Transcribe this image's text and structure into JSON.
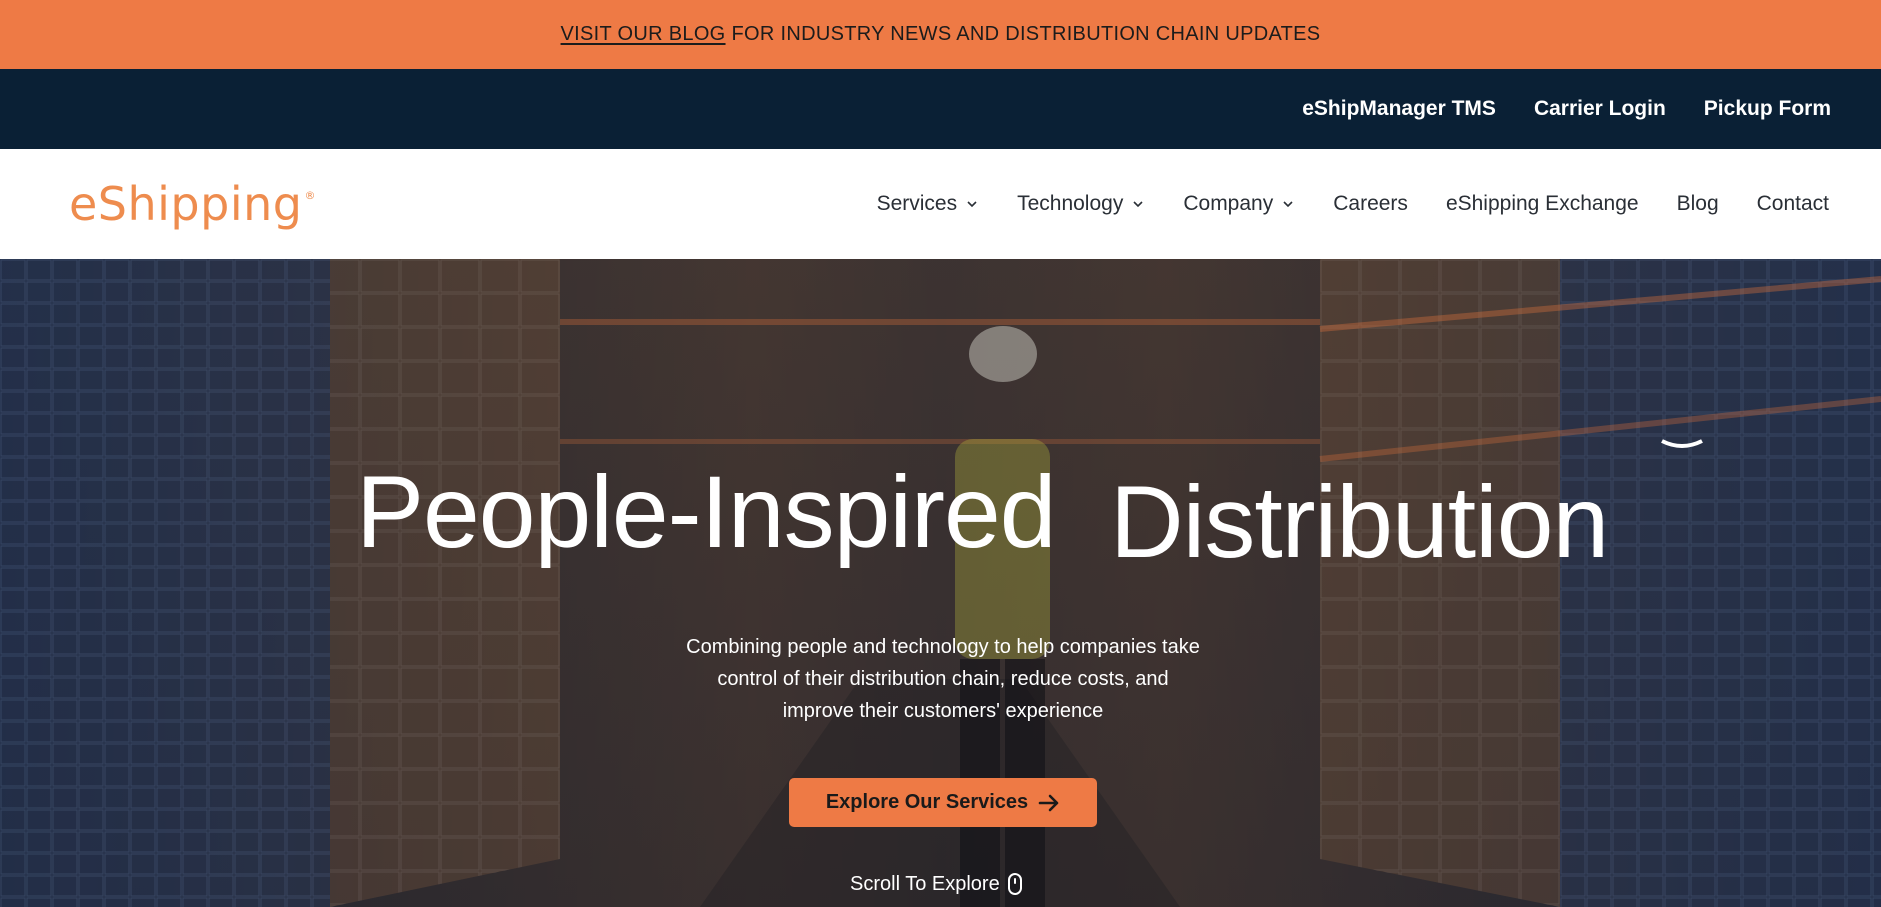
{
  "announcement": {
    "link_text": "VISIT OUR BLOG",
    "rest_text": "FOR INDUSTRY NEWS AND DISTRIBUTION CHAIN UPDATES"
  },
  "utility_nav": {
    "items": [
      "eShipManager TMS",
      "Carrier Login",
      "Pickup Form"
    ]
  },
  "logo": {
    "text": "eShipping",
    "mark": "®"
  },
  "main_nav": {
    "items": [
      {
        "label": "Services",
        "has_dropdown": true
      },
      {
        "label": "Technology",
        "has_dropdown": true
      },
      {
        "label": "Company",
        "has_dropdown": true
      },
      {
        "label": "Careers",
        "has_dropdown": false
      },
      {
        "label": "eShipping Exchange",
        "has_dropdown": false
      },
      {
        "label": "Blog",
        "has_dropdown": false
      },
      {
        "label": "Contact",
        "has_dropdown": false
      }
    ]
  },
  "hero": {
    "title_word_1": "People-Inspired",
    "title_word_2": "Distribution",
    "subtitle_lines": [
      "Combining people and technology to help companies take",
      "control of their distribution chain, reduce costs, and",
      "improve their customers' experience"
    ],
    "cta_label": "Explore Our Services",
    "scroll_label": "Scroll To Explore"
  },
  "colors": {
    "accent_orange": "#ee7a45",
    "dark_navy": "#0a2035",
    "nav_text": "#2a2f36"
  },
  "icons": {
    "chevron": "chevron-down-icon",
    "cta_arrow": "arrow-right-icon",
    "scroll": "mouse-icon"
  }
}
